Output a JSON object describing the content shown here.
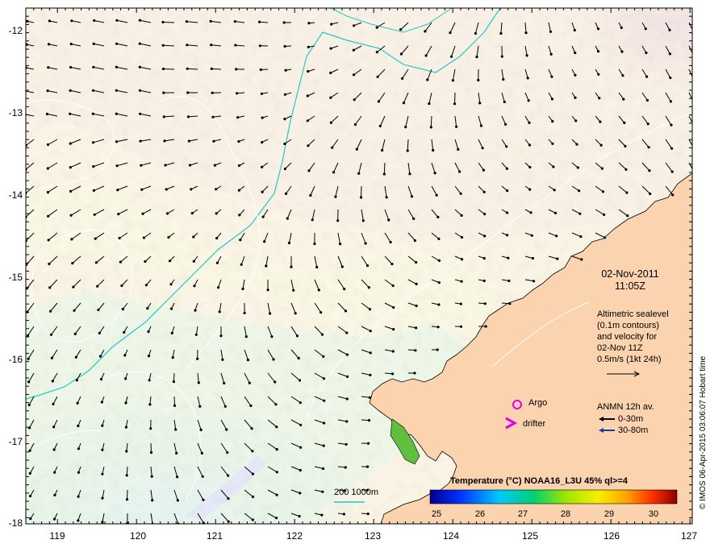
{
  "map": {
    "lon_ticks": [
      "119",
      "120",
      "121",
      "122",
      "123",
      "124",
      "125",
      "126",
      "127"
    ],
    "lat_ticks": [
      "-12",
      "-13",
      "-14",
      "-15",
      "-16",
      "-17",
      "-18"
    ],
    "lon_range": [
      118.6,
      127.0
    ],
    "lat_range": [
      -18.0,
      -11.7
    ]
  },
  "annotations": {
    "date": "02-Nov-2011",
    "time": "11:05Z",
    "altimetry_lines": [
      "Altimetric sealevel",
      "(0.1m contours)",
      "and velocity for",
      "02-Nov 11Z",
      "0.5m/s (1kt 24h)"
    ],
    "argo_label": "Argo",
    "drifter_label": "drifter",
    "anmn_title": "ANMN 12h av.",
    "anmn_shallow": "0-30m",
    "anmn_deep": "30-80m",
    "depth_contours": "200  1000m"
  },
  "colorbar": {
    "title": "Temperature (°C) NOAA16_L3U 45% ql>=4",
    "ticks": [
      "25",
      "26",
      "27",
      "28",
      "29",
      "30"
    ],
    "range": [
      24.7,
      30.6
    ]
  },
  "credit": "© IMOS 06-Apr-2015 03:06:07 Hobart time",
  "colors": {
    "land": "#fbd3ae",
    "contour": "#ffffff",
    "bathymetry": "#22c9c9",
    "argo": "#e000e0",
    "anmn_shallow": "#000000",
    "anmn_deep": "#1a3aa8"
  }
}
